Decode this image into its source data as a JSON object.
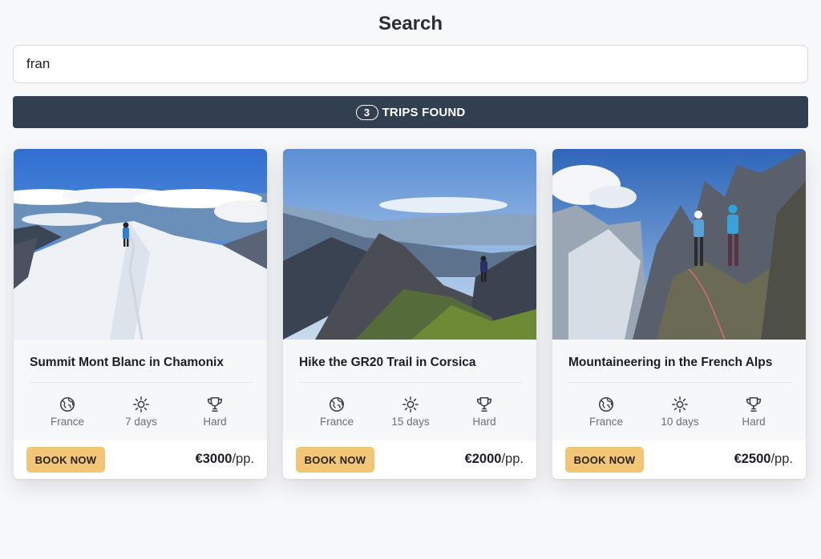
{
  "header": {
    "title": "Search"
  },
  "search": {
    "value": "fran",
    "placeholder": ""
  },
  "results": {
    "count": "3",
    "label": "TRIPS FOUND"
  },
  "colors": {
    "accent": "#f2c577",
    "results_bar": "#323f50",
    "page_bg": "#f7f8fa"
  },
  "trips": [
    {
      "title": "Summit Mont Blanc in Chamonix",
      "image": "snowy-ridge-photo",
      "country": "France",
      "duration": "7 days",
      "difficulty": "Hard",
      "book_label": "BOOK NOW",
      "price": "€3000",
      "price_unit": "/pp."
    },
    {
      "title": "Hike the GR20 Trail in Corsica",
      "image": "mountain-valley-photo",
      "country": "France",
      "duration": "15 days",
      "difficulty": "Hard",
      "book_label": "BOOK NOW",
      "price": "€2000",
      "price_unit": "/pp."
    },
    {
      "title": "Mountaineering in the French Alps",
      "image": "climbers-rock-photo",
      "country": "France",
      "duration": "10 days",
      "difficulty": "Hard",
      "book_label": "BOOK NOW",
      "price": "€2500",
      "price_unit": "/pp."
    }
  ],
  "icons": {
    "country": "globe-icon",
    "duration": "sun-icon",
    "difficulty": "trophy-icon"
  }
}
